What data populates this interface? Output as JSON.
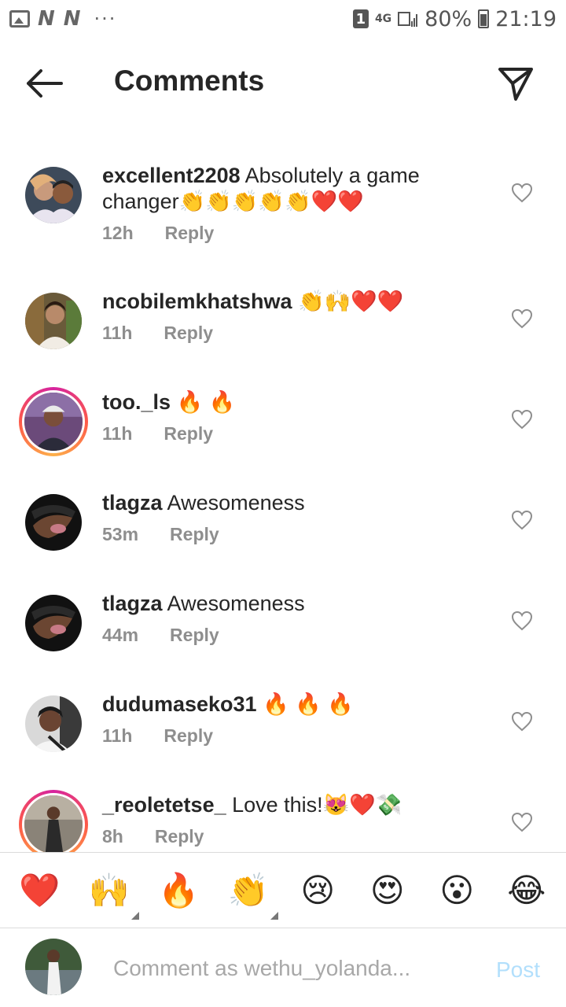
{
  "status_bar": {
    "sim_slot": "1",
    "network_label": "4G",
    "battery": "80%",
    "time": "21:19"
  },
  "header": {
    "title": "Comments",
    "back_icon": "arrow-left-icon",
    "send_icon": "paper-plane-icon"
  },
  "comments": [
    {
      "username": "excellent2208",
      "text": " Absolutely a game changer👏👏👏👏👏❤️❤️",
      "time": "12h",
      "reply": "Reply",
      "story_ring": false
    },
    {
      "username": "ncobilemkhatshwa",
      "text": " 👏🙌❤️❤️",
      "time": "11h",
      "reply": "Reply",
      "story_ring": false
    },
    {
      "username": "too._ls",
      "text": " 🔥 🔥",
      "time": "11h",
      "reply": "Reply",
      "story_ring": true
    },
    {
      "username": "tlagza",
      "text": " Awesomeness",
      "time": "53m",
      "reply": "Reply",
      "story_ring": false
    },
    {
      "username": "tlagza",
      "text": " Awesomeness",
      "time": "44m",
      "reply": "Reply",
      "story_ring": false
    },
    {
      "username": "dudumaseko31",
      "text": " 🔥 🔥 🔥",
      "time": "11h",
      "reply": "Reply",
      "story_ring": false
    },
    {
      "username": "_reoletetse_",
      "text": " Love this!😻❤️💸",
      "time": "8h",
      "reply": "Reply",
      "story_ring": true
    }
  ],
  "emoji_bar": [
    "❤️",
    "🙌",
    "🔥",
    "👏",
    "😢",
    "😍",
    "😮",
    "😂"
  ],
  "composer": {
    "placeholder": "Comment as wethu_yolanda...",
    "post_label": "Post"
  },
  "colors": {
    "text": "#262626",
    "meta": "#8e8e8e",
    "post_disabled": "#b2dffc",
    "divider": "#dbdbdb"
  }
}
